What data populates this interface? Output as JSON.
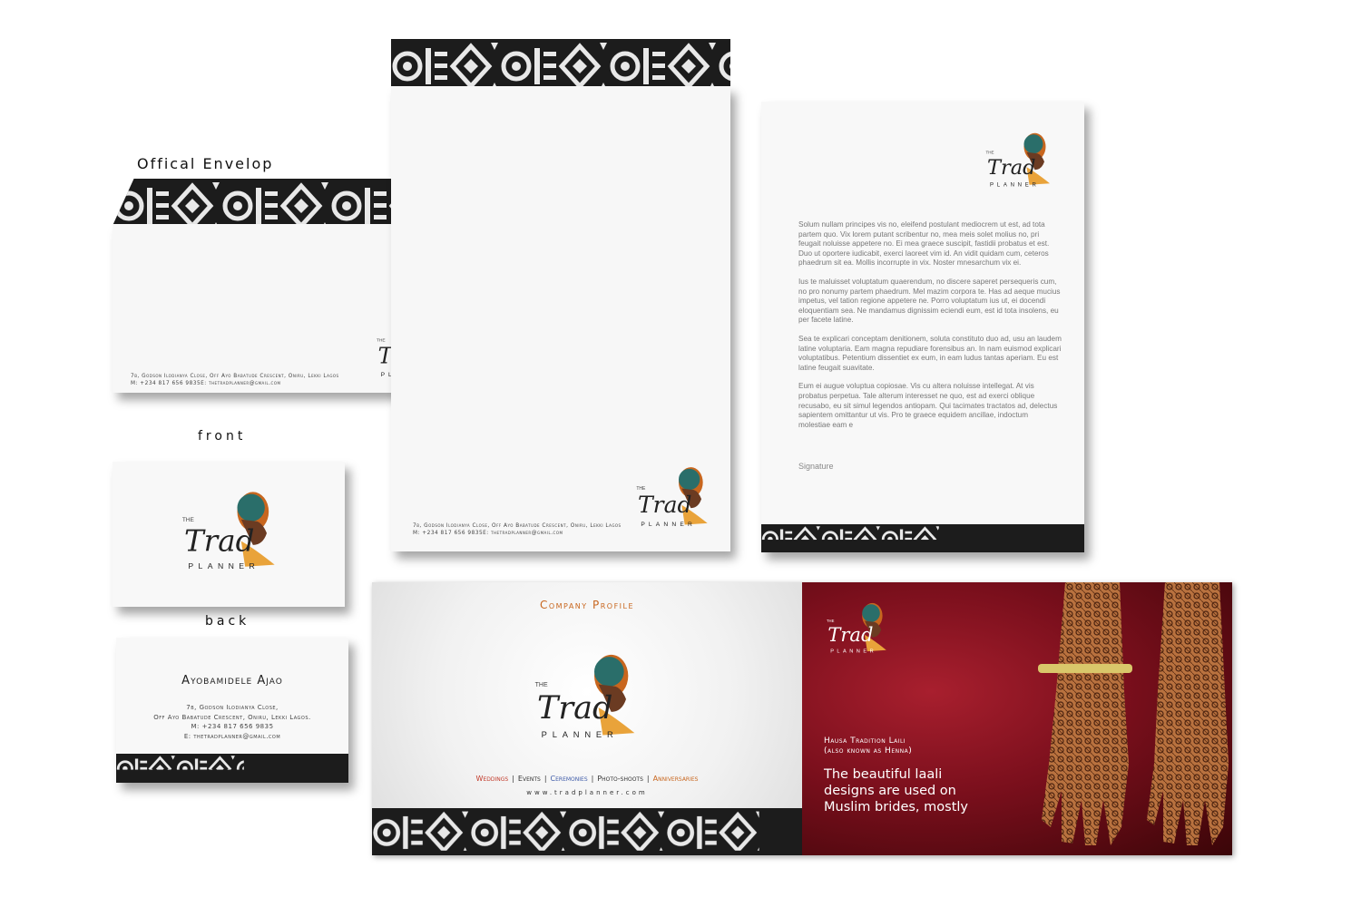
{
  "labels": {
    "envelope_caption": "Offical Envelop",
    "front_caption": "front",
    "back_caption": "back"
  },
  "brand": {
    "the": "THE",
    "trad": "Trad",
    "planner": "PLANNER"
  },
  "envelope": {
    "address_line1": "7b, Godson Ilodianya Close, Off Ayo Babatude Crescent, Oniru, Lekki Lagos",
    "address_line2": "M: +234 817 656 9835E: thetradplanner@gmail.com"
  },
  "large_envelope": {
    "address_line1": "7b, Godson Ilodianya Close, Off Ayo Babatude Crescent, Oniru, Lekki Lagos",
    "address_line2": "M: +234 817 656 9835E: thetradplanner@gmail.com"
  },
  "business_card_back": {
    "name": "Ayobamidele Ajao",
    "address1": "7b, Godson Ilodianya Close,",
    "address2": "Off Ayo Babatude Crescent, Oniru, Lekki Lagos.",
    "mobile": "M: +234 817 656 9835",
    "email": "E: thetradplanner@gmail.com"
  },
  "letterhead": {
    "paragraphs": [
      "Solum nullam principes vis no, eleifend postulant mediocrem ut est, ad tota partem quo. Vix lorem putant scribentur no, mea meis solet molius no, pri feugait noluisse appetere no. Ei mea graece suscipit, fastidii probatus et est. Duo ut oportere iudicabit, exerci laoreet vim id. An vidit quidam cum, ceteros phaedrum sit ea. Mollis incorrupte in vix. Noster mnesarchum vix ei.",
      "Ius te maluisset voluptatum quaerendum, no discere saperet persequeris cum, no pro nonumy partem phaedrum. Mel mazim corpora te. Has ad aeque mucius impetus, vel tation regione appetere ne. Porro voluptatum ius ut, ei docendi eloquentiam sea. Ne mandamus dignissim eciendi eum, est id tota insolens, eu per facete latine.",
      "Sea te explicari conceptam denitionem, soluta constituto duo ad, usu an laudem latine voluptaria. Eam magna repudiare forensibus an. In nam euismod explicari voluptatibus. Petentium dissentiet ex eum, in eam ludus tantas aperiam. Eu est latine feugait suavitate.",
      "Eum ei augue voluptua copiosae. Vis cu altera noluisse intellegat. At vis probatus perpetua. Tale alterum interesset ne quo, est ad exerci oblique recusabo, eu sit simul legendos antiopam. Qui tacimates tractatos ad, delectus sapientem omittantur ut vis. Pro te graece equidem ancillae, indoctum molestiae eam e"
    ],
    "signature": "Signature"
  },
  "profile": {
    "heading": "Company Profile",
    "services": [
      "Weddings",
      "Events",
      "Ceremonies",
      "Photo-shoots",
      "Anniversaries"
    ],
    "website": "www.tradplanner.com",
    "henna_title1": "Hausa Tradition Laili",
    "henna_title2": "(also known as Henna)",
    "henna_caption1": "The beautiful laali",
    "henna_caption2": "designs are used on",
    "henna_caption3": "Muslim brides, mostly"
  },
  "colors": {
    "pattern_dark": "#1c1c1c",
    "pattern_light": "#e8e8e8",
    "accent_orange": "#c8661e",
    "accent_red": "#c23a2a",
    "accent_blue": "#3d5aa8",
    "henna_bg": "#7a0f1c"
  }
}
